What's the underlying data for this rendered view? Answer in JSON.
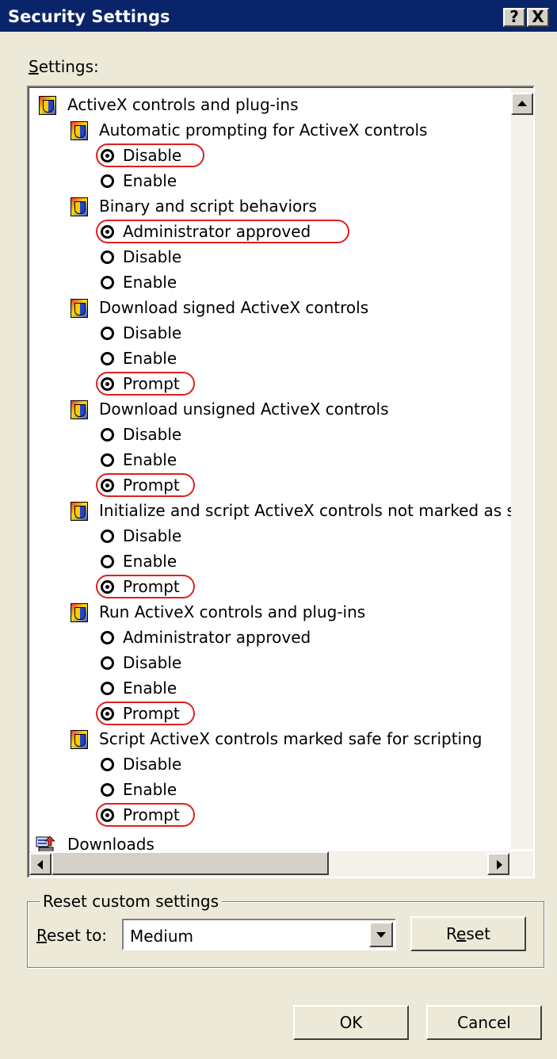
{
  "window": {
    "title": "Security Settings",
    "help_button": "?",
    "close_button": "X"
  },
  "settings_label": {
    "mnemonic": "S",
    "rest": "ettings:"
  },
  "tree": {
    "root_label": "ActiveX controls and plug-ins",
    "groups": [
      {
        "label": "Automatic prompting for ActiveX controls",
        "options": [
          {
            "label": "Disable",
            "selected": true
          },
          {
            "label": "Enable",
            "selected": false
          }
        ]
      },
      {
        "label": "Binary and script behaviors",
        "options": [
          {
            "label": "Administrator approved",
            "selected": true
          },
          {
            "label": "Disable",
            "selected": false
          },
          {
            "label": "Enable",
            "selected": false
          }
        ]
      },
      {
        "label": "Download signed ActiveX controls",
        "options": [
          {
            "label": "Disable",
            "selected": false
          },
          {
            "label": "Enable",
            "selected": false
          },
          {
            "label": "Prompt",
            "selected": true
          }
        ]
      },
      {
        "label": "Download unsigned ActiveX controls",
        "options": [
          {
            "label": "Disable",
            "selected": false
          },
          {
            "label": "Enable",
            "selected": false
          },
          {
            "label": "Prompt",
            "selected": true
          }
        ]
      },
      {
        "label": "Initialize and script ActiveX controls not marked as safe",
        "options": [
          {
            "label": "Disable",
            "selected": false
          },
          {
            "label": "Enable",
            "selected": false
          },
          {
            "label": "Prompt",
            "selected": true
          }
        ]
      },
      {
        "label": "Run ActiveX controls and plug-ins",
        "options": [
          {
            "label": "Administrator approved",
            "selected": false
          },
          {
            "label": "Disable",
            "selected": false
          },
          {
            "label": "Enable",
            "selected": false
          },
          {
            "label": "Prompt",
            "selected": true
          }
        ]
      },
      {
        "label": "Script ActiveX controls marked safe for scripting",
        "options": [
          {
            "label": "Disable",
            "selected": false
          },
          {
            "label": "Enable",
            "selected": false
          },
          {
            "label": "Prompt",
            "selected": true
          }
        ]
      }
    ],
    "last_item_label": "Downloads"
  },
  "reset_group": {
    "title": "Reset custom settings",
    "reset_to_mnemonic": "R",
    "reset_to_rest": "eset to:",
    "selected_level": "Medium",
    "reset_button_pre": "R",
    "reset_button_mnemonic": "e",
    "reset_button_post": "set"
  },
  "footer": {
    "ok_label": "OK",
    "cancel_label": "Cancel"
  },
  "colors": {
    "titlebar": "#0a246a",
    "dialog_bg": "#ece9d8",
    "highlight": "#e02020"
  }
}
